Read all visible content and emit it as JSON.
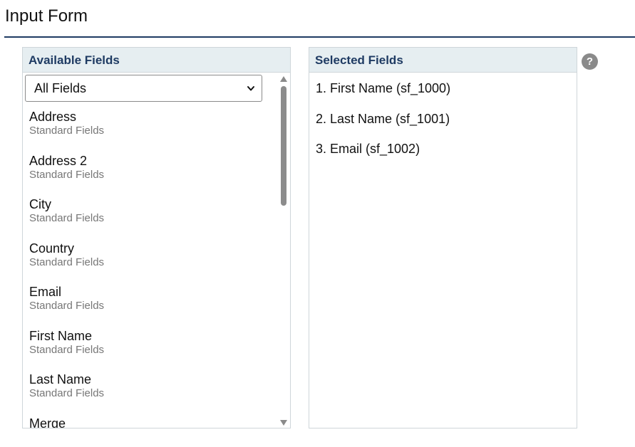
{
  "page": {
    "title": "Input Form"
  },
  "available": {
    "header": "Available Fields",
    "filter_value": "All Fields",
    "items": [
      {
        "name": "Address",
        "group": "Standard Fields"
      },
      {
        "name": "Address 2",
        "group": "Standard Fields"
      },
      {
        "name": "City",
        "group": "Standard Fields"
      },
      {
        "name": "Country",
        "group": "Standard Fields"
      },
      {
        "name": "Email",
        "group": "Standard Fields"
      },
      {
        "name": "First Name",
        "group": "Standard Fields"
      },
      {
        "name": "Last Name",
        "group": "Standard Fields"
      },
      {
        "name": "Merge",
        "group": ""
      }
    ]
  },
  "selected": {
    "header": "Selected Fields",
    "items": [
      "1. First Name (sf_1000)",
      "2. Last Name (sf_1001)",
      "3. Email (sf_1002)"
    ]
  },
  "help": {
    "glyph": "?"
  },
  "colors": {
    "header_text": "#1f3b63",
    "header_bg": "#e6eef1",
    "rule": "#1f3b63",
    "secondary_text": "#777777"
  },
  "icons": {
    "help": "help-icon",
    "dropdown": "chevron-down-icon",
    "scroll_up": "scroll-up-arrow-icon",
    "scroll_down": "scroll-down-arrow-icon"
  }
}
